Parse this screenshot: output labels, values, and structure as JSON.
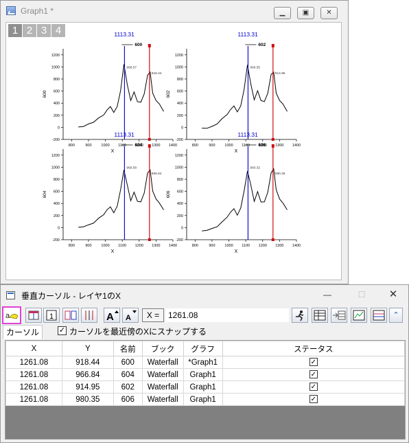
{
  "graph_window": {
    "title": "Graph1 *",
    "layer_tabs": [
      "1",
      "2",
      "3",
      "4"
    ],
    "active_layer": 0,
    "minimize_icon": "minimize-icon",
    "maximize_icon": "maximize-icon",
    "close_icon": "close-icon"
  },
  "panels": [
    {
      "name": "600",
      "cursor_label": "1113.31",
      "blue_label": "968.57",
      "red_label": "918.44"
    },
    {
      "name": "602",
      "cursor_label": "1113.31",
      "blue_label": "969.55",
      "red_label": "914.95"
    },
    {
      "name": "604",
      "cursor_label": "1113.31",
      "blue_label": "969.58",
      "red_label": "966.84"
    },
    {
      "name": "606",
      "cursor_label": "1113.31",
      "blue_label": "960.32",
      "red_label": "980.35"
    }
  ],
  "chart_data": {
    "type": "line",
    "xlabel": "X",
    "xlim": [
      750,
      1400
    ],
    "ylim": [
      -200,
      1300
    ],
    "x_ticks": [
      "800",
      "900",
      "1000",
      "1100",
      "1200",
      "1300",
      "1400"
    ],
    "y_ticks": [
      "-200",
      "0",
      "200",
      "400",
      "600",
      "800",
      "1000",
      "1200"
    ],
    "blue_cursor_x": 1113.31,
    "red_cursor_x": 1261.08,
    "colors": {
      "curve": "#000000",
      "blue_cursor": "#1010c0",
      "red_cursor": "#d01010",
      "label_blue": "#0000cc"
    },
    "series": [
      {
        "name": "600",
        "x": [
          840,
          870,
          900,
          930,
          960,
          990,
          1010,
          1030,
          1050,
          1070,
          1090,
          1110,
          1130,
          1150,
          1170,
          1190,
          1210,
          1230,
          1250,
          1265,
          1280,
          1300,
          1320,
          1345
        ],
        "y": [
          0,
          20,
          50,
          90,
          150,
          210,
          280,
          350,
          240,
          350,
          600,
          1050,
          700,
          450,
          580,
          430,
          410,
          560,
          860,
          920,
          560,
          450,
          380,
          270
        ]
      },
      {
        "name": "602",
        "x": [
          840,
          870,
          900,
          930,
          960,
          990,
          1010,
          1030,
          1050,
          1070,
          1090,
          1110,
          1130,
          1150,
          1170,
          1190,
          1210,
          1230,
          1250,
          1265,
          1280,
          1300,
          1320,
          1345
        ],
        "y": [
          -20,
          -10,
          10,
          60,
          140,
          220,
          290,
          360,
          250,
          360,
          620,
          1040,
          710,
          460,
          600,
          450,
          420,
          570,
          870,
          920,
          560,
          450,
          380,
          270
        ]
      },
      {
        "name": "604",
        "x": [
          840,
          870,
          900,
          930,
          960,
          990,
          1010,
          1030,
          1050,
          1070,
          1090,
          1110,
          1130,
          1150,
          1170,
          1190,
          1210,
          1230,
          1250,
          1265,
          1280,
          1300,
          1320,
          1345
        ],
        "y": [
          0,
          20,
          40,
          80,
          150,
          220,
          290,
          350,
          240,
          360,
          620,
          960,
          700,
          450,
          580,
          440,
          420,
          580,
          900,
          960,
          600,
          480,
          400,
          300
        ]
      },
      {
        "name": "606",
        "x": [
          840,
          870,
          900,
          930,
          960,
          990,
          1010,
          1030,
          1050,
          1070,
          1090,
          1110,
          1130,
          1150,
          1170,
          1190,
          1210,
          1230,
          1250,
          1265,
          1280,
          1300,
          1320,
          1345
        ],
        "y": [
          -60,
          -40,
          -20,
          20,
          90,
          180,
          250,
          320,
          200,
          330,
          600,
          940,
          700,
          440,
          590,
          430,
          420,
          590,
          900,
          980,
          620,
          480,
          400,
          300
        ]
      }
    ]
  },
  "dialog": {
    "title": "垂直カーソル - レイヤ1のX",
    "min_glyph": "—",
    "max_glyph": "☐",
    "close_glyph": "✕",
    "x_label": "X =",
    "x_value": "1261.08",
    "tab_label": "カーソル",
    "snap_label": "カーソルを最近傍のXにスナップする",
    "snap_checked": true,
    "toolbar_icons": [
      "cursor-tool-icon",
      "new-cursor-icon",
      "layer-one-icon",
      "pair-cursor-icon",
      "cursor-lines-icon",
      "font-increase-icon",
      "font-decrease-icon",
      "runner-icon",
      "output-table-icon",
      "export-grid-icon",
      "output-graph-icon",
      "settings-icon",
      "collapse-icon"
    ],
    "table": {
      "headers": [
        "X",
        "Y",
        "名前",
        "ブック",
        "グラフ",
        "ステータス"
      ],
      "rows": [
        {
          "x": "1261.08",
          "y": "918.44",
          "name": "600",
          "book": "Waterfall",
          "graph": "*Graph1",
          "status": true
        },
        {
          "x": "1261.08",
          "y": "966.84",
          "name": "604",
          "book": "Waterfall",
          "graph": "Graph1",
          "status": true
        },
        {
          "x": "1261.08",
          "y": "914.95",
          "name": "602",
          "book": "Waterfall",
          "graph": "Graph1",
          "status": true
        },
        {
          "x": "1261.08",
          "y": "980.35",
          "name": "606",
          "book": "Waterfall",
          "graph": "Graph1",
          "status": true
        }
      ]
    }
  }
}
